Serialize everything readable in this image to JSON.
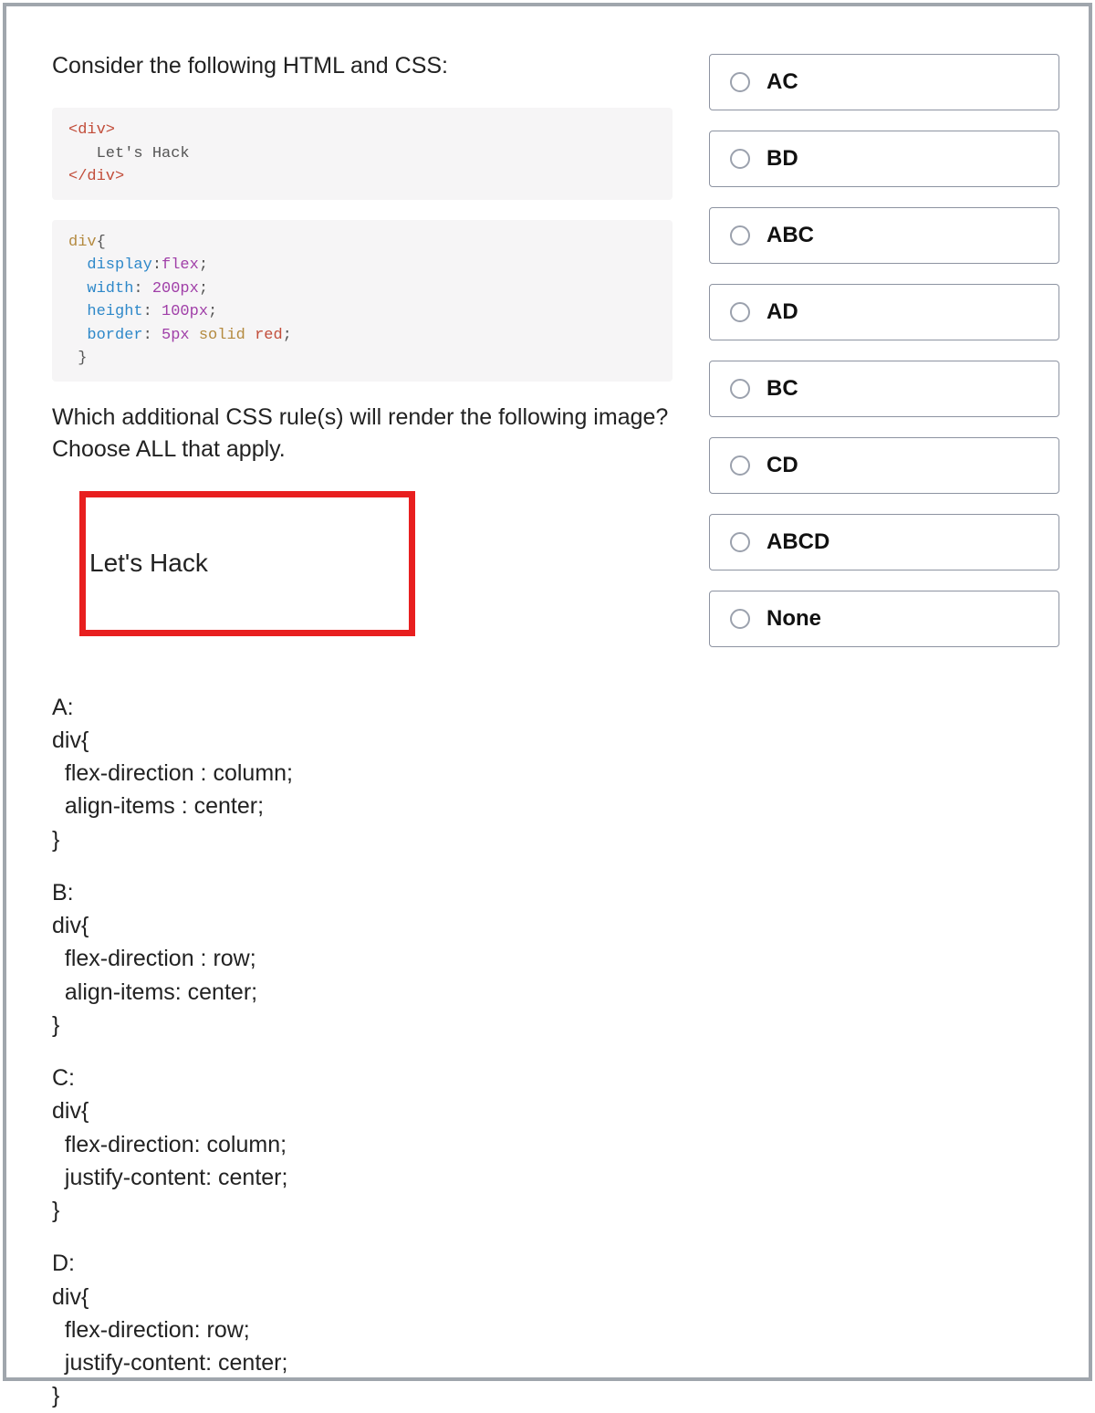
{
  "question_intro": "Consider the following HTML and CSS:",
  "code_html": {
    "line1_open": "<div>",
    "line2_text": "   Let's Hack",
    "line3_close": "</div>"
  },
  "code_css": {
    "sel": "div",
    "brace_open": "{",
    "p1_prop": "display",
    "p1_val": "flex",
    "p2_prop": "width",
    "p2_val": "200px",
    "p3_prop": "height",
    "p3_val": "100px",
    "p4_prop": "border",
    "p4_val_num": "5px",
    "p4_val_kw": "solid",
    "p4_val_color": "red",
    "brace_close": " }"
  },
  "question_followup": "Which additional CSS rule(s) will render the following image? Choose ALL that apply.",
  "render_text": "Let's Hack",
  "options": {
    "A": "A:\ndiv{\n  flex-direction : column;\n  align-items : center;\n}",
    "B": "B:\ndiv{\n  flex-direction : row;\n  align-items: center;\n}",
    "C": "C:\ndiv{\n  flex-direction: column;\n  justify-content: center;\n}",
    "D": "D:\ndiv{\n  flex-direction: row;\n  justify-content: center;\n}"
  },
  "choices": [
    "AC",
    "BD",
    "ABC",
    "AD",
    "BC",
    "CD",
    "ABCD",
    "None"
  ]
}
